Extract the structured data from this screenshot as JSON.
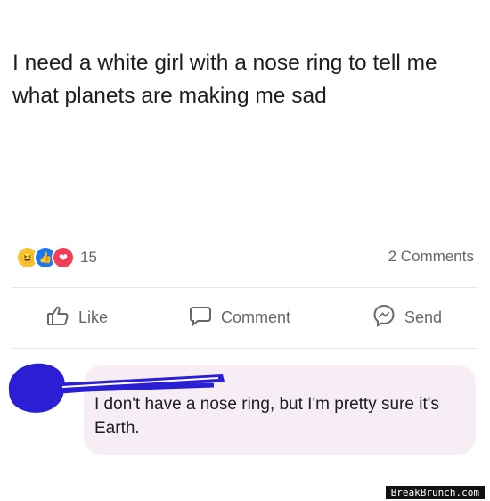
{
  "post": {
    "text": "I need a white girl with a nose ring to tell me what planets are making me sad"
  },
  "reactions": {
    "icons": [
      "haha-icon",
      "like-icon",
      "love-icon"
    ],
    "count": "15",
    "comments": "2 Comments"
  },
  "actions": {
    "like": "Like",
    "comment": "Comment",
    "send": "Send"
  },
  "comment": {
    "text": "I don't have a nose ring, but I'm pretty sure it's Earth."
  },
  "watermark": "BreakBrunch.com",
  "colors": {
    "scribble": "#2b1fd6",
    "bubble": "#f6eef4",
    "secondary_text": "#65676b"
  }
}
